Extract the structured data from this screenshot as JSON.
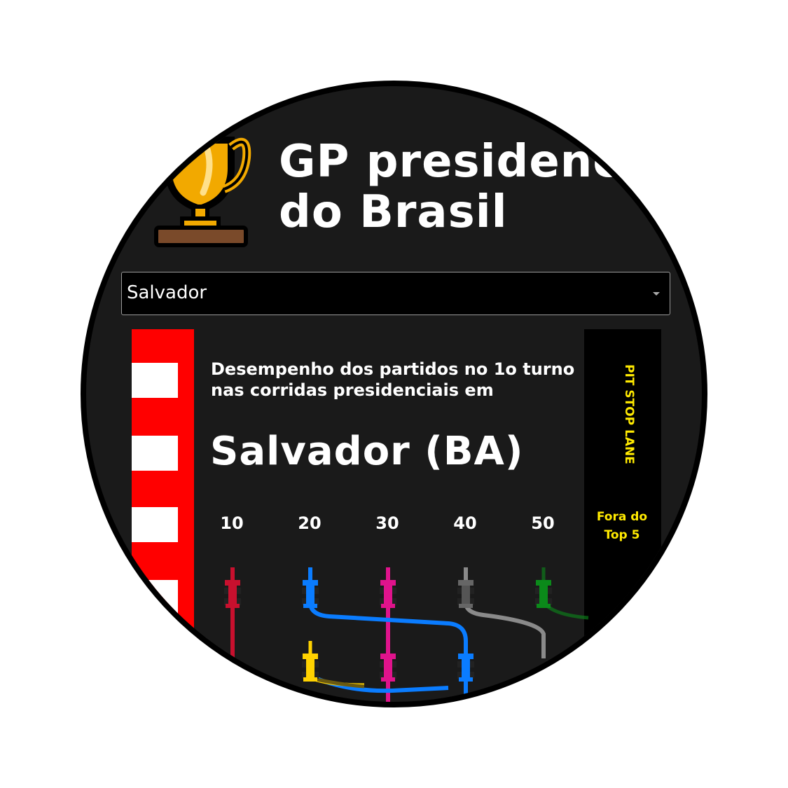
{
  "header": {
    "title_line1": "GP presidenci",
    "title_line2": "do Brasil",
    "trophy_icon": "trophy-icon"
  },
  "city_select": {
    "selected": "Salvador"
  },
  "race": {
    "subtitle": "Desempenho dos partidos no 1o turno nas corridas presidenciais em",
    "city": "Salvador (BA)",
    "laps": [
      "10",
      "20",
      "30",
      "40",
      "50"
    ],
    "pit_lane_label": "PIT STOP LANE",
    "out_label": "Fora do Top 5",
    "colors": {
      "crimson": "#c8102e",
      "blue": "#0a7cff",
      "magenta": "#e0138c",
      "gray": "#8a8a8a",
      "green": "#0b8a1a",
      "yellow": "#ffd200"
    }
  }
}
